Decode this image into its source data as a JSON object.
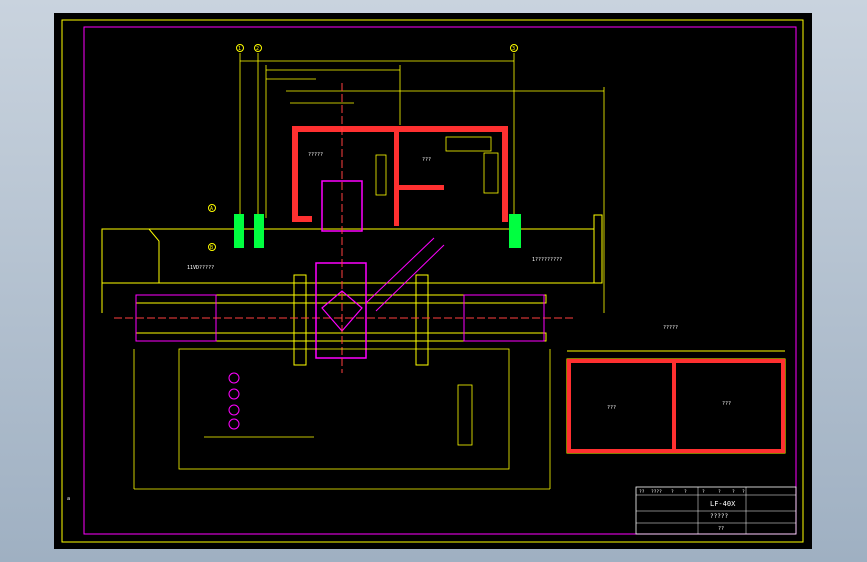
{
  "colors": {
    "background": "#000000",
    "frame": "#ff00ff",
    "border": "#ffff00",
    "dimension": "#ffff00",
    "equipment": "#ff00ff",
    "wall": "#ff3030",
    "green": "#00ff40",
    "centerline": "#ff4040",
    "text": "#ffffff",
    "window_bg": "#a8b8c8"
  },
  "drawing": {
    "label_left_room": "?????",
    "label_center_room": "???",
    "label_left_track": "11VD?????",
    "label_right_track": "1?????????",
    "label_aux_title": "?????",
    "label_aux_left": "???",
    "label_aux_right": "???",
    "corner_mark": "a",
    "axis_markers": [
      "1",
      "2",
      "3",
      "A",
      "B"
    ]
  },
  "title_block": {
    "drawing_no": "LF-40X",
    "drawing_name": "?????",
    "sign": "??",
    "header_cells": [
      "??",
      "????",
      "?",
      "?",
      "?",
      "?",
      "?",
      "?"
    ]
  }
}
